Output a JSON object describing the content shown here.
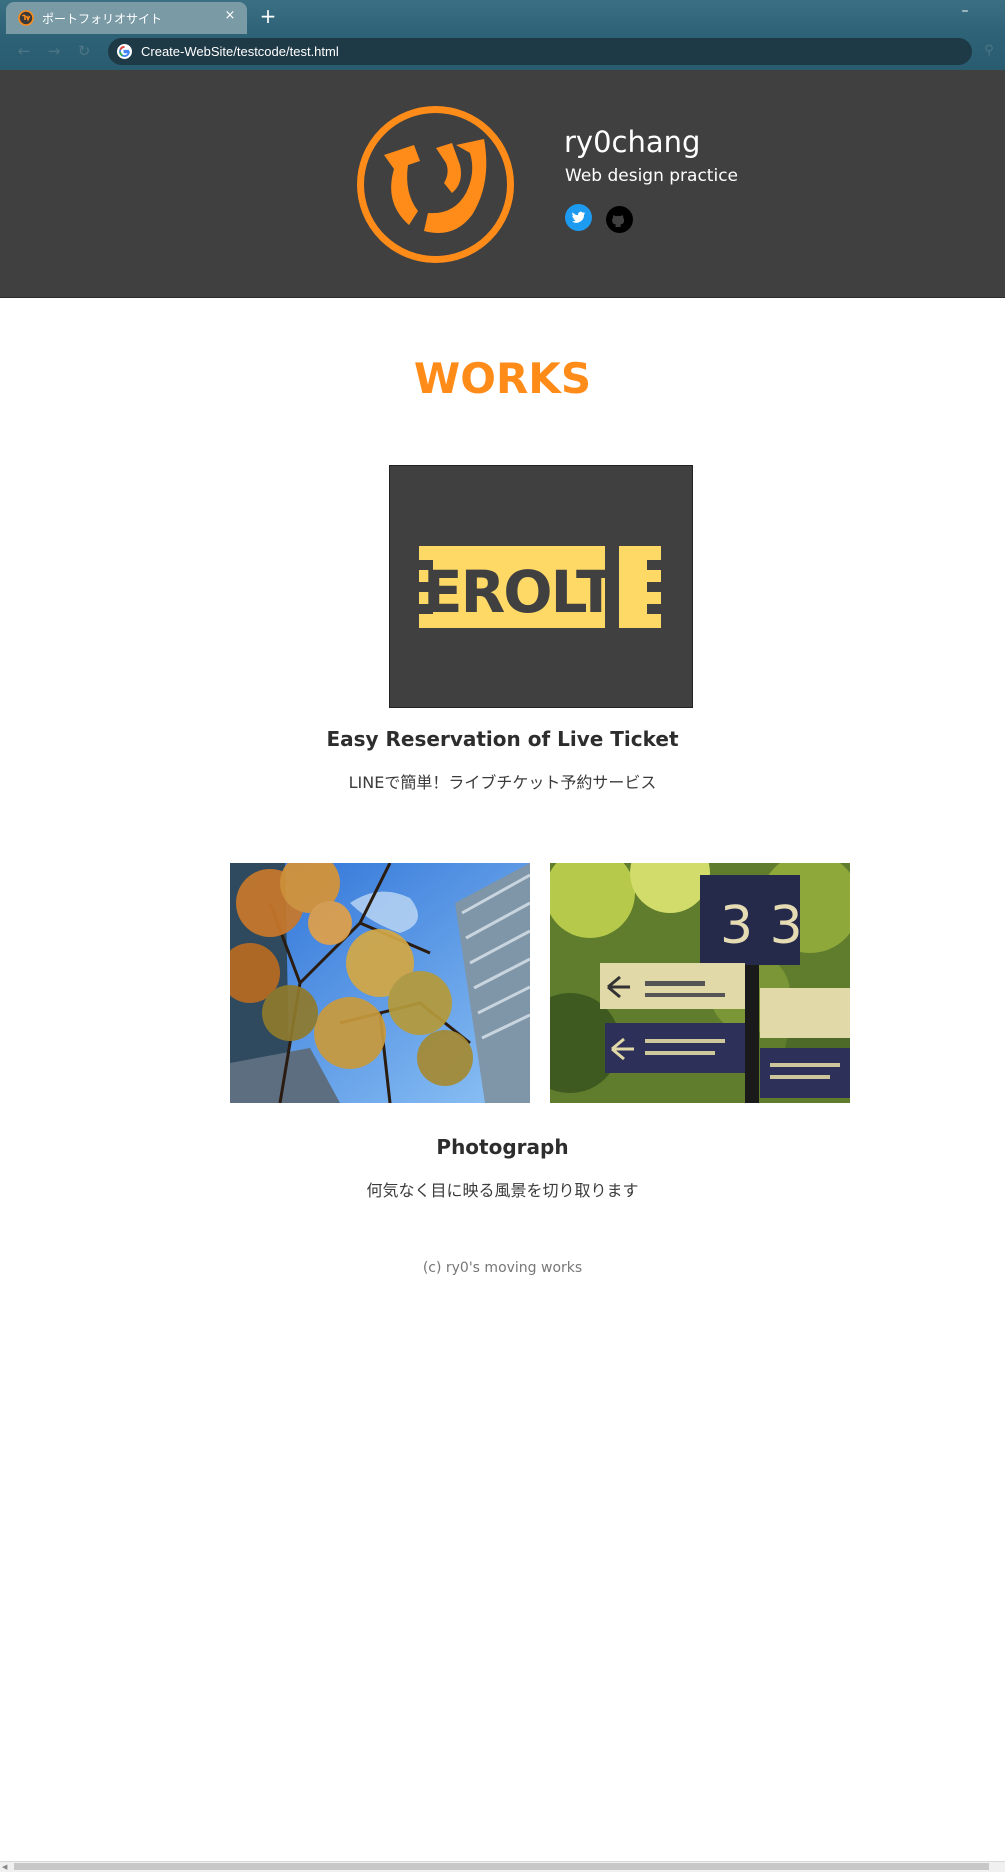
{
  "browser": {
    "tab_title": "ポートフォリオサイト",
    "tab_close": "×",
    "new_tab": "+",
    "minimize": "–",
    "url": "Create-WebSite/testcode/test.html",
    "nav": {
      "back": "←",
      "forward": "→",
      "reload": "↻"
    }
  },
  "header": {
    "name": "ry0chang",
    "tagline": "Web design practice",
    "logo_color": "#ff8b19",
    "background": "#404040",
    "social": [
      "twitter-icon",
      "github-icon"
    ]
  },
  "main": {
    "section_title": "WORKS",
    "works": [
      {
        "logo_text": "EROLT",
        "title": "Easy Reservation of Live Ticket",
        "description": "LINEで簡単！ライブチケット予約サービス"
      }
    ],
    "photograph": {
      "sign_number": "3 3",
      "title": "Photograph",
      "description": "何気なく目に映る風景を切り取ります"
    }
  },
  "footer": {
    "copyright": "(c) ry0's moving works"
  },
  "colors": {
    "accent": "#ff8b19",
    "ticket_yellow": "#ffd966",
    "chrome_blue": "#2d6277"
  }
}
